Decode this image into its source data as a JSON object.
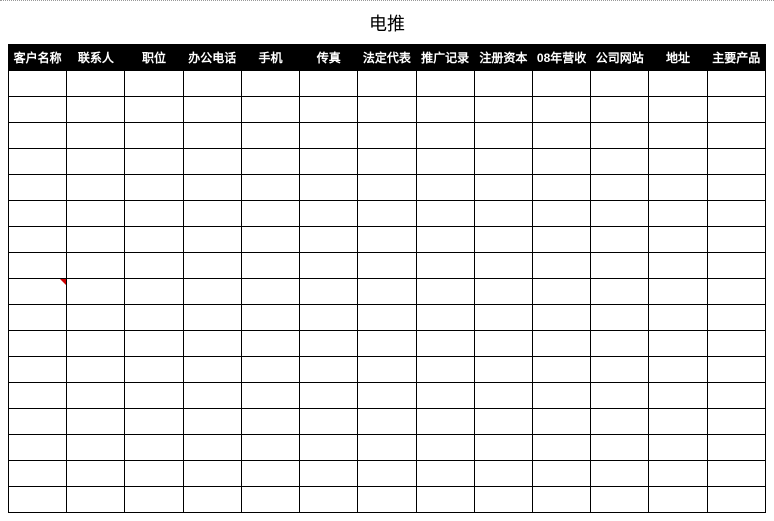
{
  "title": "电推",
  "columns": [
    "客户名称",
    "联系人",
    "职位",
    "办公电话",
    "手机",
    "传真",
    "法定代表",
    "推广记录",
    "注册资本",
    "08年营收",
    "公司网站",
    "地址",
    "主要产品"
  ],
  "rows": 17,
  "markedCell": {
    "row": 8,
    "col": 0
  }
}
